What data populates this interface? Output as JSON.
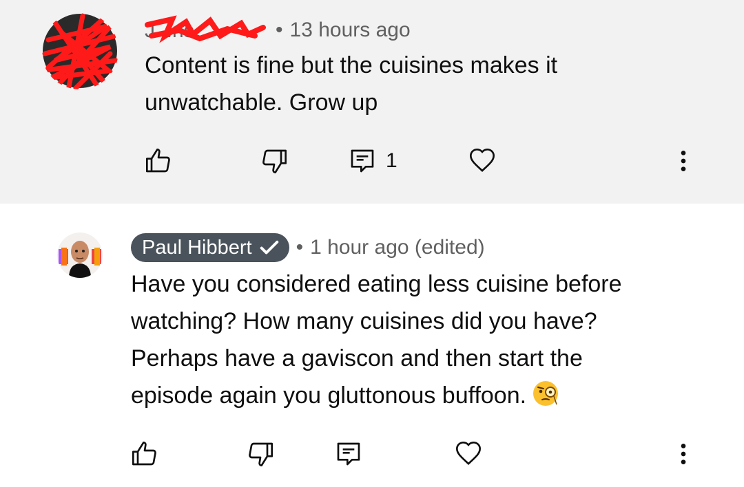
{
  "comments": [
    {
      "author": "J...ns",
      "time": "13 hours ago",
      "lines": [
        "Content is fine but the cuisines makes it",
        "unwatchable.  Grow up"
      ],
      "reply_count": "1",
      "dot": "•"
    },
    {
      "author": "Paul Hibbert",
      "time": "1 hour ago (edited)",
      "lines": [
        "Have you considered eating less cuisine before",
        "watching? How many cuisines did you have?",
        "Perhaps have a gaviscon and then start the",
        "episode again you gluttonous buffoon."
      ],
      "emoji": "face-with-monocle",
      "dot": "•"
    }
  ],
  "colors": {
    "top_background": "#f2f2f2",
    "chip": "#4a535b",
    "scribble": "#ff1a1a",
    "text": "#0f0f0f",
    "meta": "#606060"
  },
  "icons": [
    "like-icon",
    "dislike-icon",
    "reply-icon",
    "heart-icon",
    "more-vert-icon",
    "verified-check-icon"
  ]
}
